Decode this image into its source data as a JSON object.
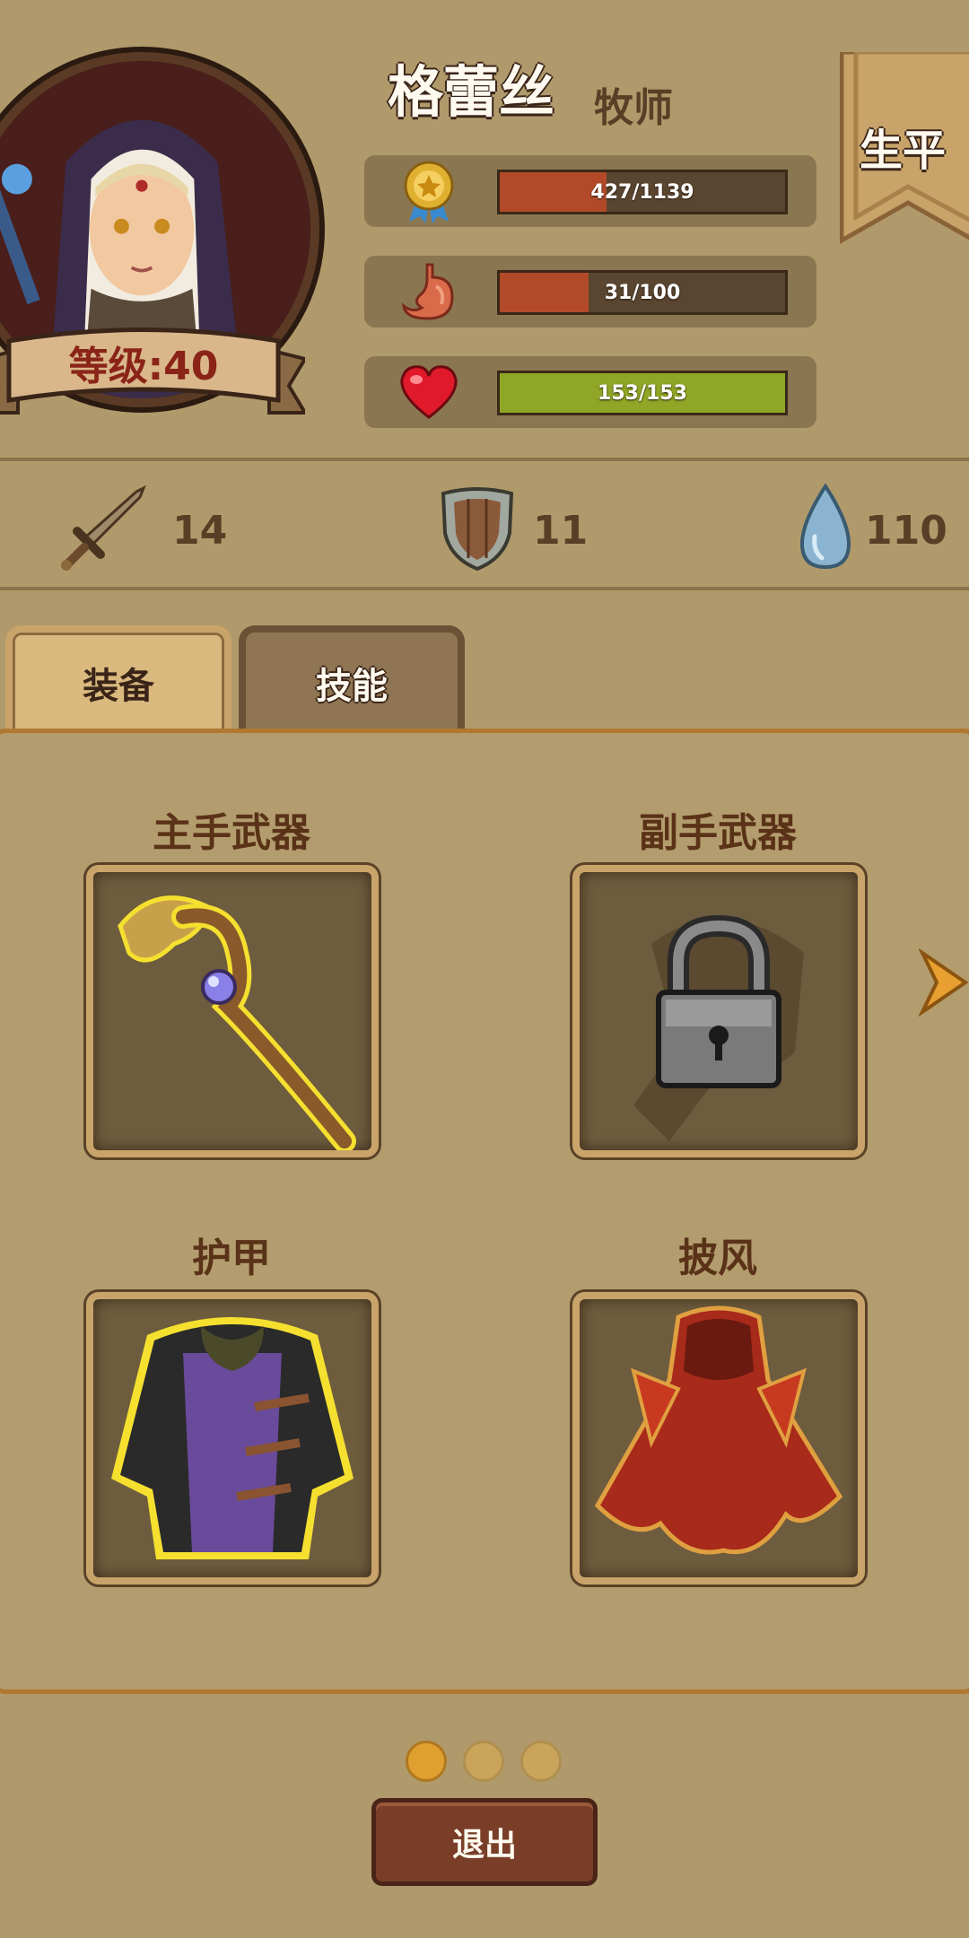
{
  "character": {
    "name": "格蕾丝",
    "class": "牧师",
    "level_label": "等级:40"
  },
  "banner": {
    "label": "生平"
  },
  "stats": {
    "experience": {
      "text": "427/1139",
      "value": 427,
      "max": 1139,
      "color": "#b24a2a",
      "icon": "medal-icon"
    },
    "hunger": {
      "text": "31/100",
      "value": 31,
      "max": 100,
      "color": "#b24a2a",
      "icon": "stomach-icon"
    },
    "health": {
      "text": "153/153",
      "value": 153,
      "max": 153,
      "color": "#8fa626",
      "icon": "heart-icon"
    }
  },
  "attributes": {
    "attack": {
      "value": "14",
      "icon": "sword-icon"
    },
    "defense": {
      "value": "11",
      "icon": "shield-icon"
    },
    "mana": {
      "value": "110",
      "icon": "water-drop-icon"
    }
  },
  "tabs": [
    {
      "label": "装备",
      "active": true
    },
    {
      "label": "技能",
      "active": false
    }
  ],
  "equipment": {
    "main_hand": {
      "label": "主手武器",
      "item": "staff-icon"
    },
    "off_hand": {
      "label": "副手武器",
      "item": "lock-icon",
      "locked": true
    },
    "armor": {
      "label": "护甲",
      "item": "robe-icon"
    },
    "cloak": {
      "label": "披风",
      "item": "cloak-icon"
    }
  },
  "pagination": {
    "current": 1,
    "total": 3
  },
  "exit_button": {
    "label": "退出"
  }
}
